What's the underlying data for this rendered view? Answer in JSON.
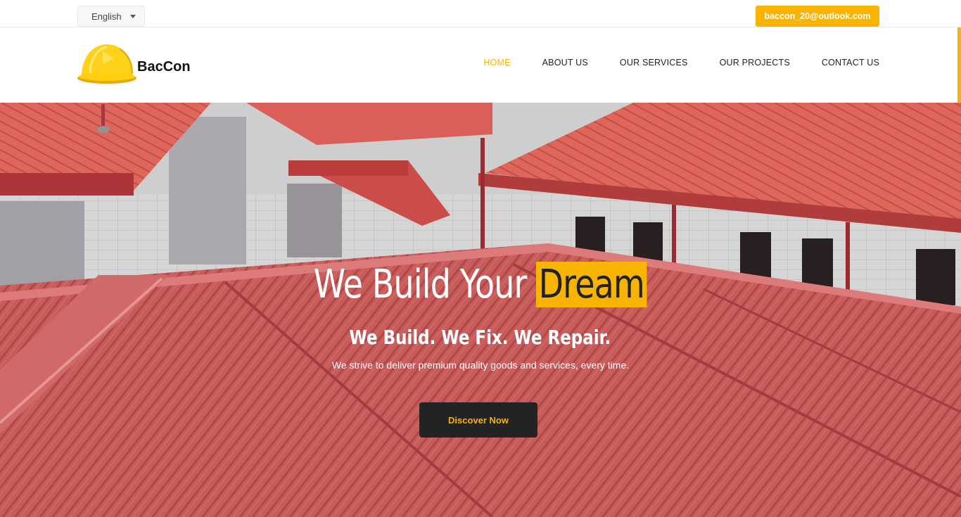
{
  "topbar": {
    "language": "English",
    "email": "baccon_20@outlook.com"
  },
  "brand": {
    "name": "BacCon"
  },
  "nav": {
    "items": [
      {
        "label": "HOME",
        "active": true
      },
      {
        "label": "ABOUT US",
        "active": false
      },
      {
        "label": "OUR SERVICES",
        "active": false
      },
      {
        "label": "OUR PROJECTS",
        "active": false
      },
      {
        "label": "CONTACT US",
        "active": false
      }
    ]
  },
  "hero": {
    "title_prefix": "We Build Your",
    "title_highlight": "Dream",
    "subtitle": "We Build. We Fix. We Repair.",
    "description": "We strive to deliver premium quality goods and services, every time.",
    "cta_label": "Discover Now"
  },
  "colors": {
    "accent": "#f8b400",
    "dark": "#232323",
    "roof": "#c8575a"
  },
  "icons": {
    "logo": "hard-hat-icon",
    "language_caret": "caret-down-icon"
  }
}
